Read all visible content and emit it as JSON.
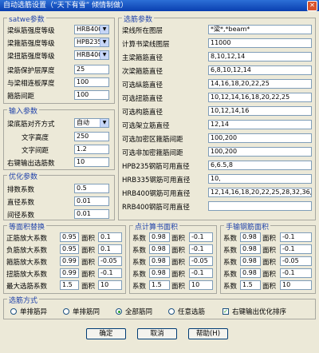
{
  "window": {
    "title": "自动选筋设置（“天下有雪” 倾情制做）"
  },
  "satwe": {
    "caption": "satwe参数",
    "rows": [
      {
        "label": "梁纵筋强度等级",
        "value": "HRB400"
      },
      {
        "label": "梁箍筋强度等级",
        "value": "HPB235"
      },
      {
        "label": "梁扭筋强度等级",
        "value": "HRB400"
      },
      {
        "label": "梁筋保护层厚度",
        "value": "25"
      },
      {
        "label": "与梁相连板厚度",
        "value": "100"
      },
      {
        "label": "箍筋间距",
        "value": "100"
      }
    ]
  },
  "input": {
    "caption": "输入参数",
    "rows": [
      {
        "label": "梁底筋对齐方式",
        "value": "自动"
      },
      {
        "label": "文字高度",
        "value": "250"
      },
      {
        "label": "文字间距",
        "value": "1.2"
      },
      {
        "label": "右键输出选筋数",
        "value": "10"
      }
    ]
  },
  "opt": {
    "caption": "优化参数",
    "rows": [
      {
        "label": "排数系数",
        "value": "0.5"
      },
      {
        "label": "直径系数",
        "value": "0.01"
      },
      {
        "label": "间径系数",
        "value": "0.01"
      }
    ]
  },
  "select": {
    "caption": "选筋参数",
    "rows": [
      {
        "label": "梁线所在图层",
        "value": "*梁*,*beam*"
      },
      {
        "label": "计算书梁线图层",
        "value": "11000"
      },
      {
        "label": "主梁箍筋直径",
        "value": "8,10,12,14"
      },
      {
        "label": "次梁箍筋直径",
        "value": "6,8,10,12,14"
      },
      {
        "label": "可选纵筋直径",
        "value": "14,16,18,20,22,25"
      },
      {
        "label": "可选扭筋直径",
        "value": "10,12,14,16,18,20,22,25"
      },
      {
        "label": "可选构筋直径",
        "value": "10,12,14,16"
      },
      {
        "label": "可选架立筋直径",
        "value": "12,14"
      },
      {
        "label": "可选加密区箍筋间距",
        "value": "100,200"
      },
      {
        "label": "可选非加密箍筋间距",
        "value": "100,200"
      },
      {
        "label": "HPB235钢筋可用直径",
        "value": "6,6.5,8"
      },
      {
        "label": "HRB335钢筋可用直径",
        "value": "10,"
      },
      {
        "label": "HRB400钢筋可用直径",
        "value": "12,14,16,18,20,22,25,28,32,36,40"
      },
      {
        "label": "RRB400钢筋可用直径",
        "value": ""
      }
    ]
  },
  "equiv": {
    "caption": "等面积替换",
    "rows": [
      {
        "label": "正筋放大系数",
        "a": "0.95",
        "b": "0.1"
      },
      {
        "label": "负筋放大系数",
        "a": "0.95",
        "b": "0.1"
      },
      {
        "label": "箍筋放大系数",
        "a": "0.99",
        "b": "-0.05"
      },
      {
        "label": "扭筋放大系数",
        "a": "0.99",
        "b": "-0.1"
      },
      {
        "label": "最大选筋系数",
        "a": "1.5",
        "b": "10"
      }
    ],
    "area_label": "面积"
  },
  "calc": {
    "caption": "点计算书面积",
    "coef_label": "系数",
    "area_label": "面积",
    "rows": [
      {
        "a": "0.98",
        "b": "-0.1"
      },
      {
        "a": "0.98",
        "b": "-0.1"
      },
      {
        "a": "0.98",
        "b": "-0.05"
      },
      {
        "a": "0.98",
        "b": "-0.1"
      },
      {
        "a": "1.5",
        "b": "10"
      }
    ]
  },
  "manual": {
    "caption": "手输钢筋面积",
    "coef_label": "系数",
    "area_label": "面积",
    "rows": [
      {
        "a": "0.98",
        "b": "-0.1"
      },
      {
        "a": "0.98",
        "b": "-0.1"
      },
      {
        "a": "0.98",
        "b": "-0.05"
      },
      {
        "a": "0.98",
        "b": "-0.1"
      },
      {
        "a": "1.5",
        "b": "10"
      }
    ]
  },
  "mode": {
    "caption": "选筋方式",
    "options": [
      "单排筋异",
      "单排筋同",
      "全部筋同",
      "任意选筋"
    ],
    "selected_index": 2,
    "checkbox_label": "右键输出优化排序",
    "checkbox_checked": true
  },
  "buttons": {
    "ok": "确定",
    "cancel": "取消",
    "help": "帮助(H)"
  }
}
